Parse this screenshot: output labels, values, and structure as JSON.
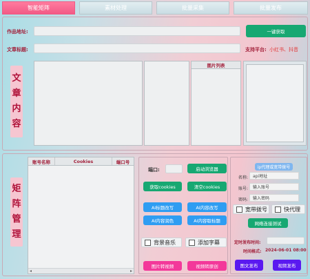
{
  "tabs": [
    {
      "label": "智能矩阵",
      "active": true
    },
    {
      "label": "素材处理",
      "active": false
    },
    {
      "label": "批量采集",
      "active": false
    },
    {
      "label": "批量发布",
      "active": false
    }
  ],
  "article": {
    "url_label": "作品地址:",
    "title_label": "文章标题:",
    "extract_button": "一键获取",
    "platform_label": "支持平台:",
    "platforms": "小红书、抖音",
    "section_label": [
      "文",
      "章",
      "内",
      "容"
    ],
    "image_list_header": "图片列表"
  },
  "matrix": {
    "section_label": [
      "矩",
      "阵",
      "管",
      "理"
    ],
    "table_headers": [
      "账号名称",
      "Cookies",
      "端口号"
    ],
    "port_label": "端口:",
    "buttons": {
      "start_browser": "启动浏览器",
      "get_cookies": "获取cookies",
      "clear_cookies": "清空cookies",
      "ai_title_rewrite": "AI标题改写",
      "ai_content_rewrite": "AI内容改写",
      "ai_content_polish": "AI内容润色",
      "ai_content_tags": "AI内容取标题",
      "image_to_video": "图片转视频",
      "video_to_image": "视频转原创",
      "publish_image_text": "图文发布",
      "publish_video": "视频发布",
      "test_network": "网络连接测试"
    },
    "checkboxes": {
      "background_music": "背景音乐",
      "add_subtitles": "添加字幕",
      "broadband_dial": "宽带拨号",
      "fast_proxy": "快代理"
    },
    "proxy": {
      "title": "ip代理或宽带拨号",
      "name_label": "名称:",
      "name_value": "api地址",
      "account_label": "账号:",
      "account_value": "输入账号",
      "password_label": "密码:",
      "password_value": "输入密码"
    },
    "schedule": {
      "label": "定时发布时间:",
      "format_label": "时间格式:",
      "format_value": "2024-06-01 08:00"
    }
  },
  "colors": {
    "accent_pink": "#f25a86",
    "label_red": "#a3223c",
    "green": "#17a872",
    "blue": "#2f9df2",
    "pink_button": "#f3389a",
    "purple": "#5a19f0"
  }
}
